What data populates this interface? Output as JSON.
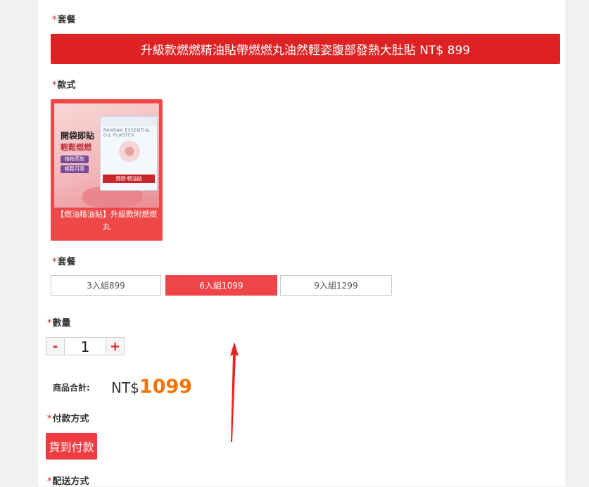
{
  "sections": {
    "package_label": "套餐",
    "style_label": "款式",
    "package_label2": "套餐",
    "quantity_label": "數量",
    "payment_label": "付款方式",
    "shipping_label": "配送方式",
    "required_mark": "*"
  },
  "banner": {
    "text": "升級款燃燃精油貼帶燃燃丸油然輕姿腹部發熱大肚貼 NT$ 899"
  },
  "style_option": {
    "caption": "【燃油精油貼】升級款附燃燃丸",
    "image_text": {
      "line1": "開袋即貼",
      "line2": "輕鬆燃燃",
      "tag1": "植物萃取",
      "tag2": "輕鬆可感",
      "box_sub": "RANRAN ESSENTIAL OIL PLASTER",
      "box_badge": "燃燃·精油貼"
    }
  },
  "package_options": [
    {
      "label": "3入組899",
      "selected": false
    },
    {
      "label": "6入組1099",
      "selected": true
    },
    {
      "label": "9入組1299",
      "selected": false
    }
  ],
  "quantity": {
    "minus": "-",
    "value": "1",
    "plus": "+"
  },
  "total": {
    "label": "商品合計:",
    "currency": "NT$",
    "amount": "1099"
  },
  "payment": {
    "option": "貨到付款"
  },
  "colors": {
    "accent_red": "#de2224",
    "active_option": "#ef4448",
    "price_orange": "#f27300",
    "arrow": "#e8231f"
  }
}
